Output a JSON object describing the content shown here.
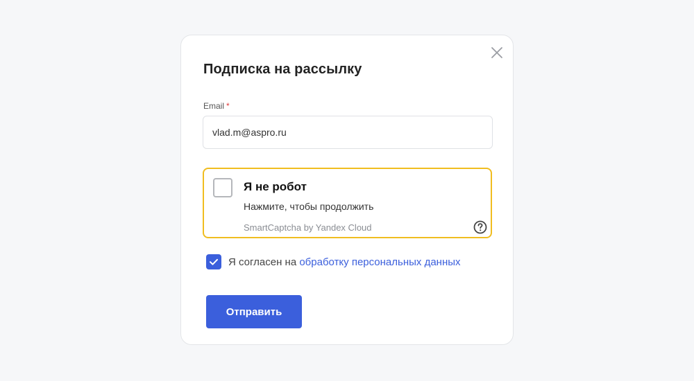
{
  "modal": {
    "title": "Подписка на рассылку",
    "close_icon": "close-icon"
  },
  "email": {
    "label": "Email",
    "required_mark": "*",
    "value": "vlad.m@aspro.ru"
  },
  "captcha": {
    "title": "Я не робот",
    "subtitle": "Нажмите, чтобы продолжить",
    "brand": "SmartCaptcha by Yandex Cloud",
    "help_icon": "help-circle-icon",
    "checked": false,
    "border_color": "#f0bd20"
  },
  "consent": {
    "checked": true,
    "text": "Я согласен на ",
    "link_text": "обработку персональных данных"
  },
  "submit": {
    "label": "Отправить"
  },
  "colors": {
    "accent": "#3b5fdc",
    "required": "#e03a3a"
  }
}
